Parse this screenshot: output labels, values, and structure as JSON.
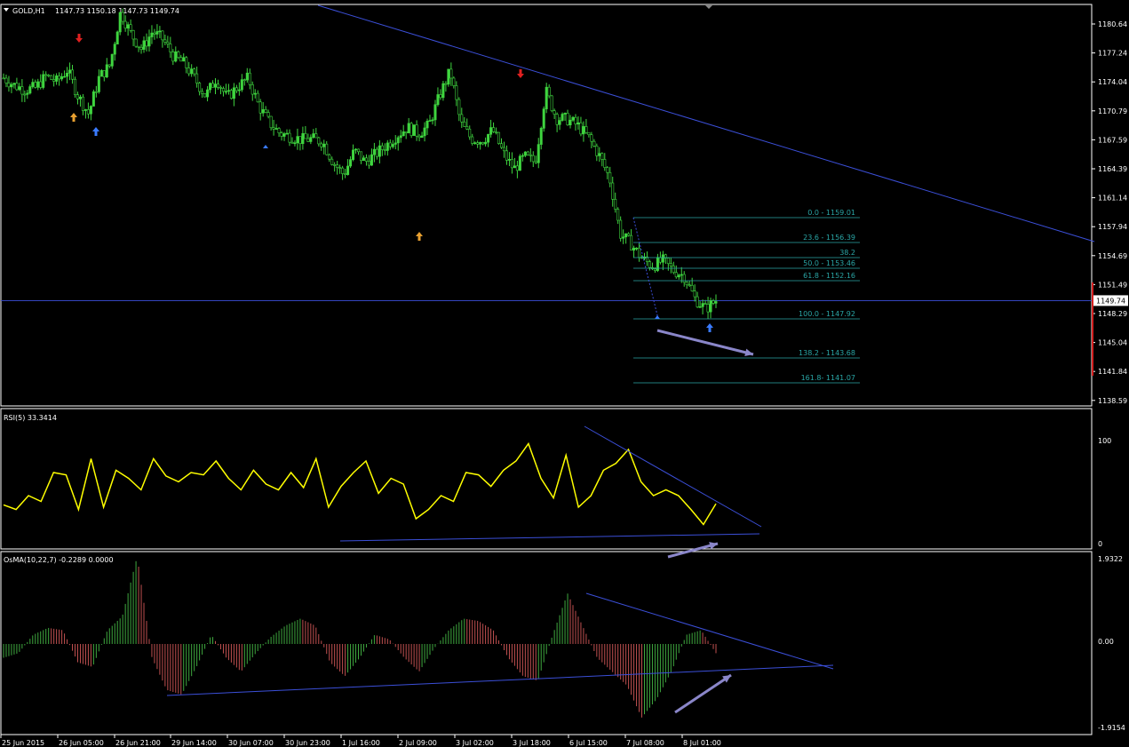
{
  "header": {
    "symbol": "GOLD,H1",
    "ohlc": "1147.73 1150.18 1147.73 1149.74",
    "rsi_title": "RSI(5) 33.3414",
    "osma_title": "OsMA(10,22,7) -0.2289 0.0000"
  },
  "price_axis": {
    "ticks": [
      "1180.64",
      "1177.24",
      "1174.04",
      "1170.79",
      "1167.59",
      "1164.39",
      "1161.14",
      "1157.94",
      "1154.69",
      "1151.49",
      "1148.29",
      "1145.04",
      "1141.84",
      "1138.59"
    ],
    "current_price": "1149.74"
  },
  "rsi_axis": {
    "ticks": [
      "100",
      "0"
    ]
  },
  "osma_axis": {
    "ticks": [
      "1.9322",
      "0.00",
      "-1.9154"
    ]
  },
  "time_axis": {
    "ticks": [
      "25 Jun 2015",
      "26 Jun 05:00",
      "26 Jun 21:00",
      "29 Jun 14:00",
      "30 Jun 07:00",
      "30 Jun 23:00",
      "1 Jul 16:00",
      "2 Jul 09:00",
      "3 Jul 02:00",
      "3 Jul 18:00",
      "6 Jul 15:00",
      "7 Jul 08:00",
      "8 Jul 01:00"
    ]
  },
  "fibonacci": {
    "levels": [
      {
        "label": "0.0 - 1159.01"
      },
      {
        "label": "23.6 - 1156.39"
      },
      {
        "label": "38.2"
      },
      {
        "label": "50.0 - 1153.46"
      },
      {
        "label": "61.8 - 1152.16"
      },
      {
        "label": "100.0 - 1147.92"
      },
      {
        "label": "138.2 - 1143.68"
      },
      {
        "label": "161.8- 1141.07"
      }
    ]
  },
  "colors": {
    "background": "#000000",
    "bull_candle": "#3fd53f",
    "rsi_line": "#ffff00",
    "trendline": "#3b4fd8",
    "arrow": "#8a86c9",
    "fib": "#2aa6a6",
    "osma_up": "#3fa83f",
    "osma_down": "#c05050",
    "grid_border": "#ffffff"
  },
  "chart_data": [
    {
      "type": "candlestick",
      "title": "GOLD,H1",
      "ylim": [
        1138.59,
        1182.0
      ],
      "x": [
        "25 Jun 2015",
        "26 Jun 05:00",
        "26 Jun 21:00",
        "29 Jun 14:00",
        "30 Jun 07:00",
        "30 Jun 23:00",
        "1 Jul 16:00",
        "2 Jul 09:00",
        "3 Jul 02:00",
        "3 Jul 18:00",
        "6 Jul 15:00",
        "7 Jul 08:00",
        "8 Jul 01:00"
      ],
      "close_path": [
        1174.6,
        1173.8,
        1173.3,
        1173.5,
        1174.8,
        1174.2,
        1175.5,
        1172.6,
        1170.6,
        1174.7,
        1176.0,
        1182.0,
        1179.5,
        1177.8,
        1179.8,
        1178.9,
        1177.0,
        1176.2,
        1174.5,
        1172.6,
        1174.6,
        1172.4,
        1173.6,
        1174.6,
        1171.5,
        1169.6,
        1168.4,
        1168.1,
        1167.7,
        1167.8,
        1167.5,
        1165.2,
        1163.8,
        1166.5,
        1165.2,
        1166.1,
        1167.1,
        1168.2,
        1169.1,
        1168.4,
        1169.3,
        1172.6,
        1175.4,
        1169.5,
        1167.8,
        1167.6,
        1168.8,
        1166.2,
        1164.4,
        1165.8,
        1165.2,
        1173.2,
        1170.1,
        1170.0,
        1169.3,
        1168.0,
        1166.0,
        1163.4,
        1157.2,
        1156.1,
        1154.5,
        1153.6,
        1154.2,
        1153.1,
        1152.5,
        1150.0,
        1148.8,
        1149.74
      ],
      "current_price": 1149.74
    },
    {
      "type": "line",
      "title": "RSI(5) 33.3414",
      "ylim": [
        0,
        100
      ],
      "values": [
        32,
        28,
        40,
        35,
        60,
        58,
        28,
        72,
        30,
        62,
        55,
        45,
        72,
        57,
        52,
        60,
        58,
        70,
        55,
        45,
        62,
        50,
        45,
        60,
        47,
        72,
        30,
        48,
        60,
        70,
        42,
        55,
        50,
        20,
        28,
        40,
        35,
        60,
        58,
        48,
        62,
        70,
        85,
        55,
        38,
        75,
        30,
        40,
        62,
        68,
        80,
        52,
        40,
        45,
        40,
        28,
        15,
        33
      ]
    },
    {
      "type": "bar",
      "title": "OsMA(10,22,7) -0.2289 0.0000",
      "ylim": [
        -1.9154,
        1.9322
      ],
      "values": [
        -0.3,
        -0.2,
        0.2,
        0.35,
        0.3,
        -0.4,
        -0.5,
        0.3,
        0.6,
        1.9,
        -0.3,
        -1.0,
        -1.1,
        -0.5,
        0.2,
        -0.3,
        -0.6,
        -0.2,
        0.15,
        0.4,
        0.55,
        0.4,
        -0.4,
        -0.7,
        -0.3,
        0.2,
        0.1,
        -0.3,
        -0.6,
        -0.1,
        0.3,
        0.55,
        0.5,
        0.3,
        -0.3,
        -0.7,
        -0.8,
        0.2,
        1.1,
        0.4,
        -0.3,
        -0.6,
        -0.9,
        -1.6,
        -1.2,
        -0.6,
        0.2,
        0.3,
        -0.2
      ]
    }
  ]
}
